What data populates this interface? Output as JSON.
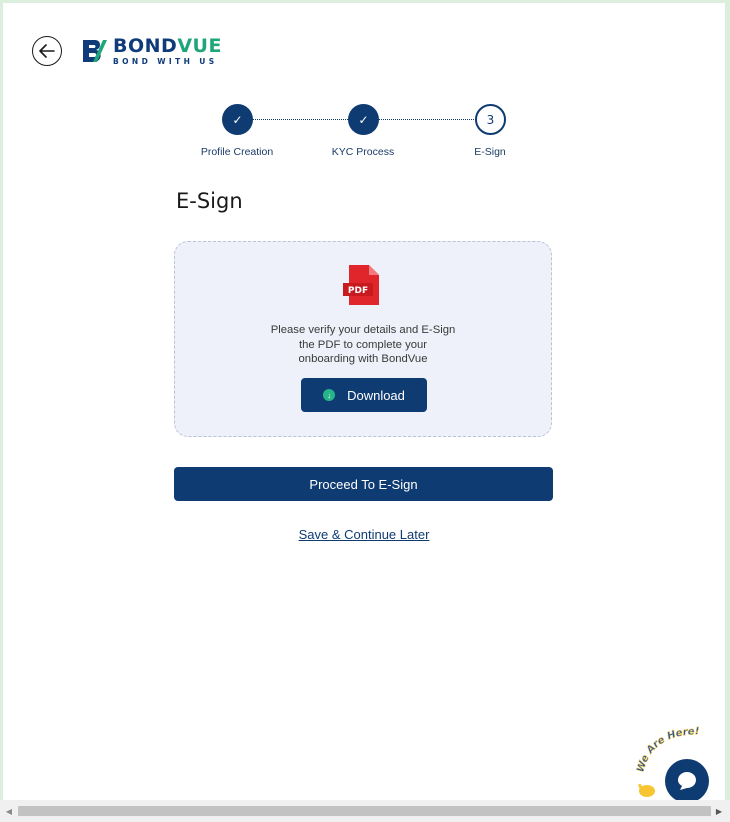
{
  "logo": {
    "name_part1": "BOND",
    "name_part2": "VUE",
    "tagline": "BOND WITH US"
  },
  "stepper": {
    "steps": [
      {
        "label": "Profile Creation",
        "state": "done",
        "marker": "✓"
      },
      {
        "label": "KYC Process",
        "state": "done",
        "marker": "✓"
      },
      {
        "label": "E-Sign",
        "state": "current",
        "marker": "3"
      }
    ]
  },
  "page": {
    "title": "E-Sign"
  },
  "card": {
    "pdf_badge": "PDF",
    "message_line1": "Please verify your details and E-Sign",
    "message_line2": "the PDF to complete your",
    "message_line3": "onboarding with BondVue",
    "download_label": "Download"
  },
  "actions": {
    "proceed_label": "Proceed To E-Sign",
    "save_later_label": "Save & Continue Later"
  },
  "chat": {
    "tagline": "We Are Here!"
  },
  "colors": {
    "primary": "#0f3b73",
    "accent": "#26b58a",
    "pdf_red": "#e0262b"
  }
}
